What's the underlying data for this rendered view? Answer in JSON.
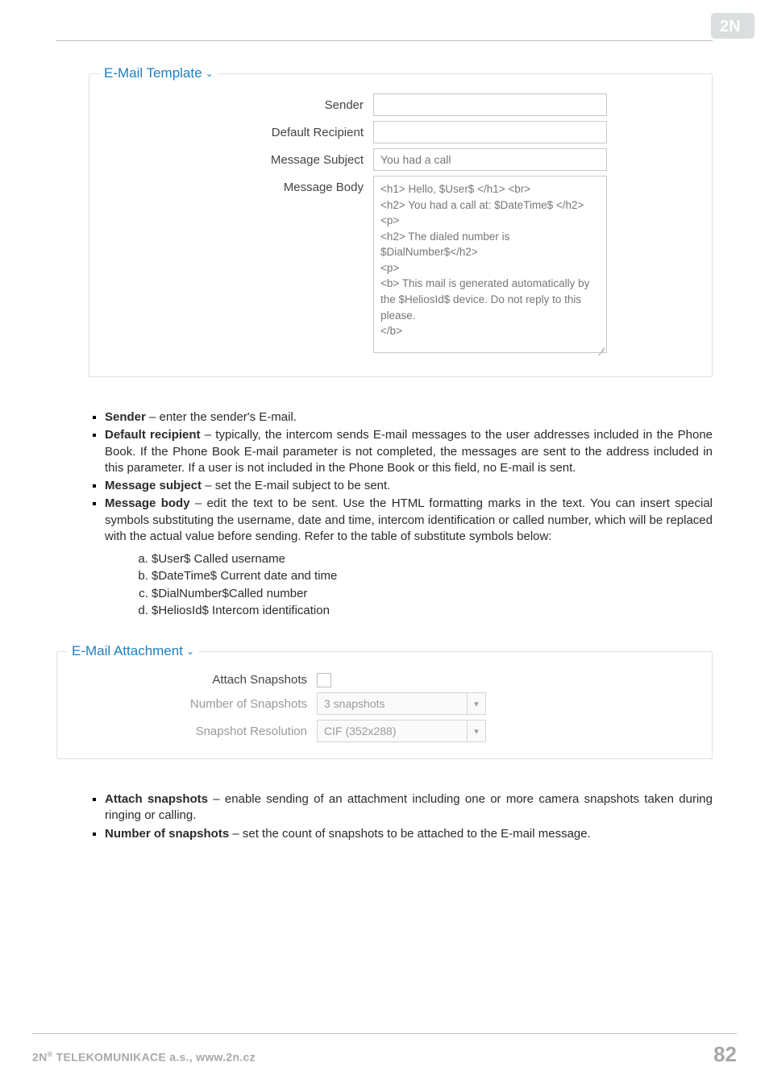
{
  "header": {
    "brand": "2N"
  },
  "figure1": {
    "legend": "E-Mail Template",
    "rows": {
      "sender": {
        "label": "Sender",
        "value": ""
      },
      "default": {
        "label": "Default Recipient",
        "value": ""
      },
      "subject": {
        "label": "Message Subject",
        "value": "You had a call"
      },
      "body": {
        "label": "Message Body",
        "value": "<h1> Hello, $User$ </h1> <br>\n<h2> You had a call at: $DateTime$ </h2>\n<p>\n<h2> The dialed number is $DialNumber$</h2>\n<p>\n<b> This mail is generated automatically by the $HeliosId$ device. Do not reply to this please.\n</b>"
      }
    }
  },
  "bullets1": {
    "sender": {
      "term": "Sender",
      "desc": " – enter the sender's E-mail."
    },
    "default": {
      "term": "Default recipient",
      "desc": " – typically, the intercom sends E-mail messages to the user addresses included in the Phone Book. If the Phone Book E-mail parameter is not completed, the messages are sent to the address included in this parameter. If a user is not included in the Phone Book or this field, no E-mail is sent."
    },
    "subject": {
      "term": "Message subject",
      "desc": " – set the E-mail subject to be sent."
    },
    "body": {
      "term": "Message body",
      "desc": " – edit the text to be sent. Use the HTML formatting marks in the text. You can insert special symbols substituting the username, date and time, intercom identification or called number, which will be replaced with the actual value before sending. Refer to the table of substitute symbols below:"
    }
  },
  "subs": {
    "a": "$User$ Called username",
    "b": "$DateTime$ Current date and time",
    "c": "$DialNumber$Called number",
    "d": "$HeliosId$ Intercom identification"
  },
  "figure2": {
    "legend": "E-Mail Attachment",
    "rows": {
      "attach": {
        "label": "Attach Snapshots"
      },
      "count": {
        "label": "Number of Snapshots",
        "value": "3 snapshots"
      },
      "res": {
        "label": "Snapshot Resolution",
        "value": "CIF (352x288)"
      }
    }
  },
  "bullets2": {
    "attach": {
      "term": "Attach snapshots",
      "desc": " – enable sending of an attachment including one or more camera snapshots taken during ringing or calling."
    },
    "count": {
      "term": "Number of snapshots",
      "desc": " – set the count of snapshots to be attached to the E-mail message."
    }
  },
  "footer": {
    "company": "2N® TELEKOMUNIKACE a.s., www.2n.cz",
    "page": "82"
  }
}
